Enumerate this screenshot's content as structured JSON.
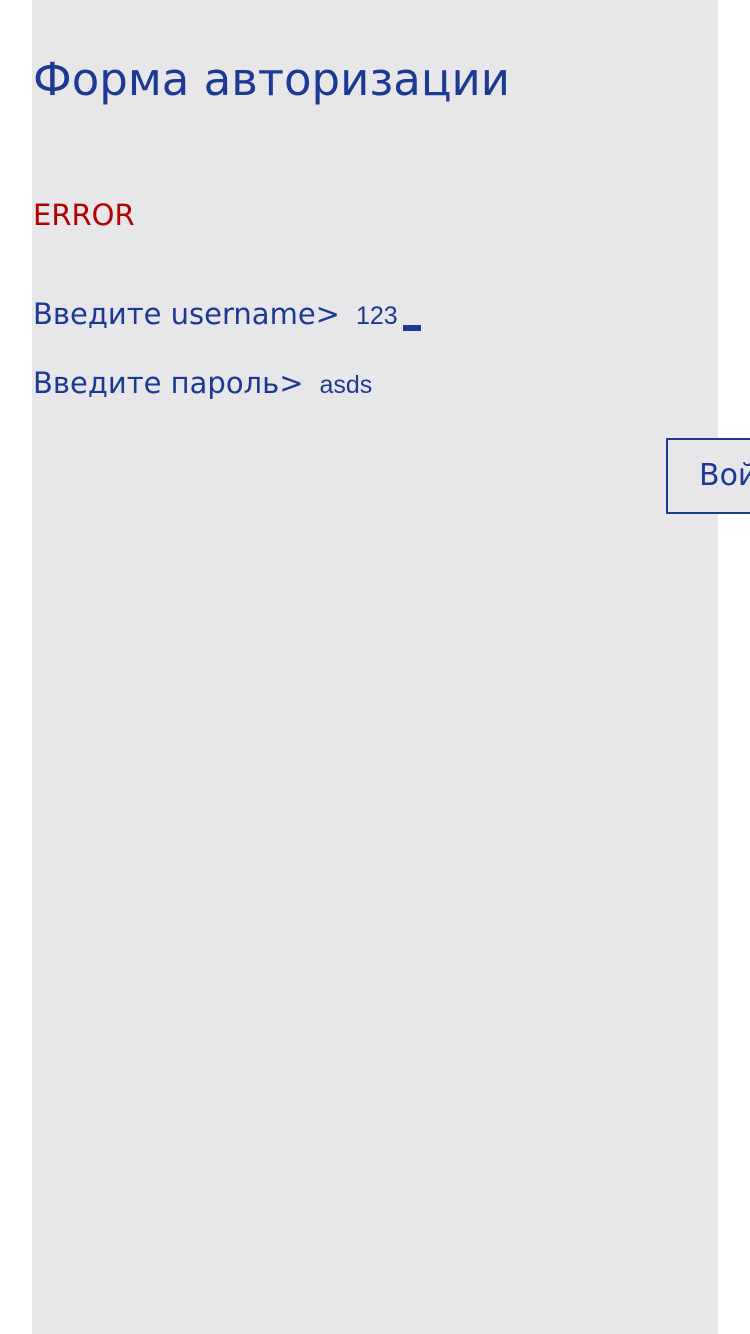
{
  "form": {
    "title": "Форма авторизации",
    "error": "ERROR",
    "username": {
      "prompt": "Введите username>",
      "value": "123"
    },
    "password": {
      "prompt": "Введите пароль>",
      "value": "asds"
    },
    "submit_label": "Войти"
  },
  "colors": {
    "text": "#1c3a94",
    "error": "#b30000",
    "panel": "#e7e7ea"
  }
}
